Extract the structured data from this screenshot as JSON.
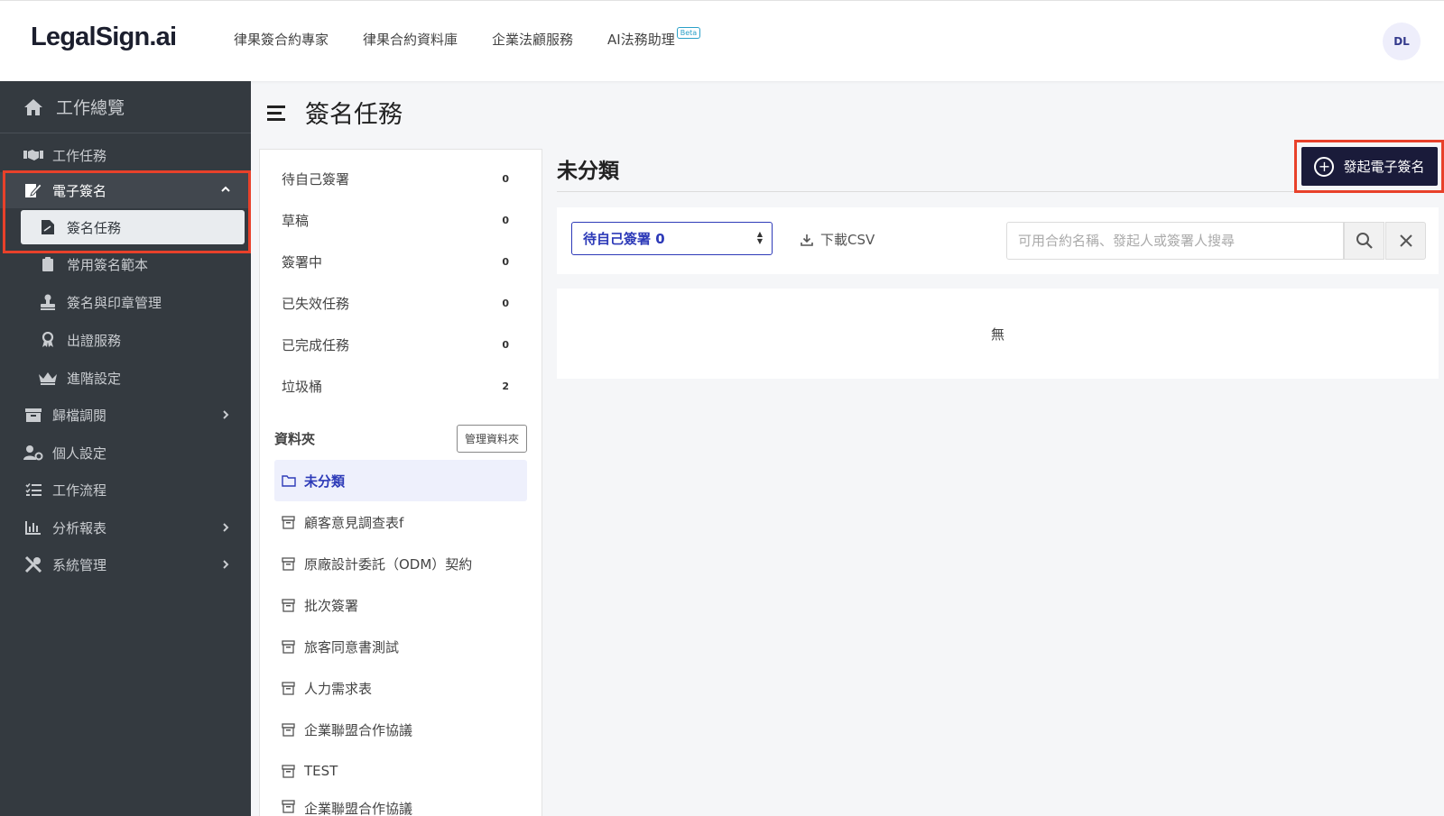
{
  "brand": {
    "logo": "LegalSign.ai"
  },
  "topnav": {
    "items": [
      "律果簽合約專家",
      "律果合約資料庫",
      "企業法顧服務",
      "AI法務助理"
    ],
    "beta_badge": "Beta",
    "avatar_initials": "DL"
  },
  "sidebar": {
    "home": "工作總覽",
    "items": [
      {
        "label": "工作任務",
        "icon": "handshake-icon"
      },
      {
        "label": "電子簽名",
        "icon": "signature-icon",
        "expanded": true
      },
      {
        "label": "簽名任務",
        "icon": "file-signature-icon",
        "active": true
      },
      {
        "label": "常用簽名範本",
        "icon": "clipboard-icon"
      },
      {
        "label": "簽名與印章管理",
        "icon": "stamp-icon"
      },
      {
        "label": "出證服務",
        "icon": "award-icon"
      },
      {
        "label": "進階設定",
        "icon": "crown-icon"
      },
      {
        "label": "歸檔調閱",
        "icon": "archive-icon"
      },
      {
        "label": "個人設定",
        "icon": "user-cog-icon"
      },
      {
        "label": "工作流程",
        "icon": "tasks-icon"
      },
      {
        "label": "分析報表",
        "icon": "chart-bar-icon"
      },
      {
        "label": "系統管理",
        "icon": "tools-icon"
      }
    ]
  },
  "page": {
    "title": "簽名任務"
  },
  "status_list": [
    {
      "label": "待自己簽署",
      "count": "0"
    },
    {
      "label": "草稿",
      "count": "0"
    },
    {
      "label": "簽署中",
      "count": "0"
    },
    {
      "label": "已失效任務",
      "count": "0"
    },
    {
      "label": "已完成任務",
      "count": "0"
    },
    {
      "label": "垃圾桶",
      "count": "2"
    }
  ],
  "folders": {
    "header": "資料夾",
    "manage_label": "管理資料夾",
    "items": [
      {
        "label": "未分類",
        "active": true
      },
      {
        "label": "顧客意見調查表f"
      },
      {
        "label": "原廠設計委託（ODM）契約"
      },
      {
        "label": "批次簽署"
      },
      {
        "label": "旅客同意書測試"
      },
      {
        "label": "人力需求表"
      },
      {
        "label": "企業聯盟合作協議"
      },
      {
        "label": "TEST"
      },
      {
        "label": "企業聯盟合作協議"
      }
    ]
  },
  "main": {
    "section_title": "未分類",
    "primary_button": "發起電子簽名",
    "filter_select": "待自己簽署 0",
    "download_csv": "下載CSV",
    "search_placeholder": "可用合約名稱、發起人或簽署人搜尋",
    "empty_text": "無"
  },
  "colors": {
    "sidebar_bg": "#343a40",
    "accent": "#2d3ab8",
    "primary_button_bg": "#1a1b3a",
    "highlight": "#e8412a"
  }
}
